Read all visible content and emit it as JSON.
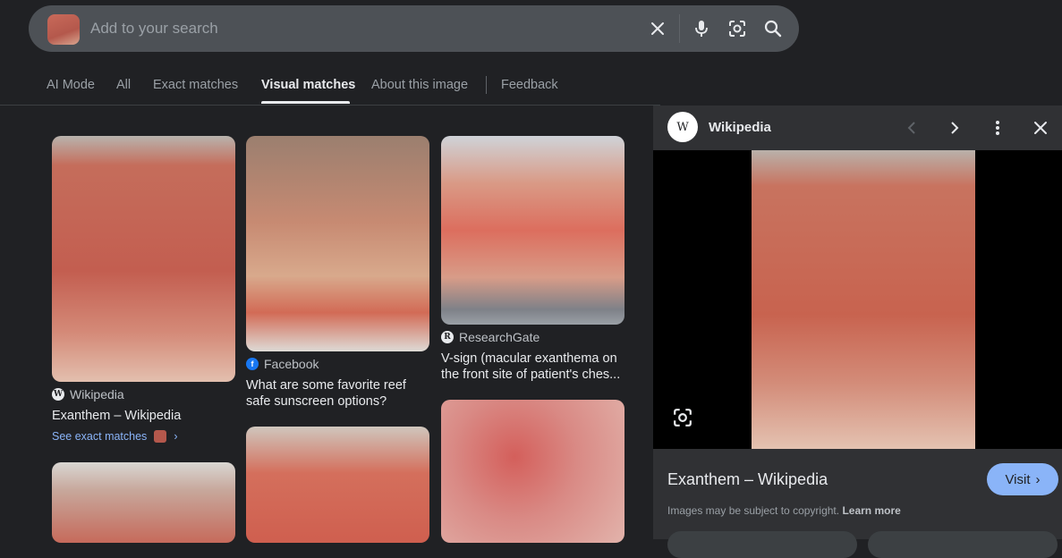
{
  "search": {
    "placeholder": "Add to your search"
  },
  "tabs": [
    {
      "label": "AI Mode"
    },
    {
      "label": "All"
    },
    {
      "label": "Exact matches"
    },
    {
      "label": "Visual matches"
    },
    {
      "label": "About this image"
    },
    {
      "label": "Feedback"
    }
  ],
  "active_tab": "Visual matches",
  "results": [
    {
      "source": "Wikipedia",
      "title": "Exanthem – Wikipedia",
      "exact_label": "See exact matches"
    },
    {
      "source": "Facebook",
      "title_line1": "What are some favorite reef",
      "title_line2": "safe sunscreen options?"
    },
    {
      "source": "ResearchGate",
      "title_line1": "V-sign (macular exanthema on",
      "title_line2": "the front site of patient's ches..."
    }
  ],
  "panel": {
    "site": "Wikipedia",
    "site_logo_letter": "W",
    "title": "Exanthem – Wikipedia",
    "visit_label": "Visit",
    "copyright_text": "Images may be subject to copyright.",
    "learn_more": "Learn more"
  },
  "colors": {
    "background": "#202124",
    "searchbar": "#4d5156",
    "panel": "#303134",
    "link": "#8ab4f8",
    "visit_button": "#8ab4f8"
  },
  "icons": [
    "clear-icon",
    "microphone-icon",
    "lens-icon",
    "search-icon",
    "prev-icon",
    "next-icon",
    "more-icon",
    "close-icon"
  ]
}
